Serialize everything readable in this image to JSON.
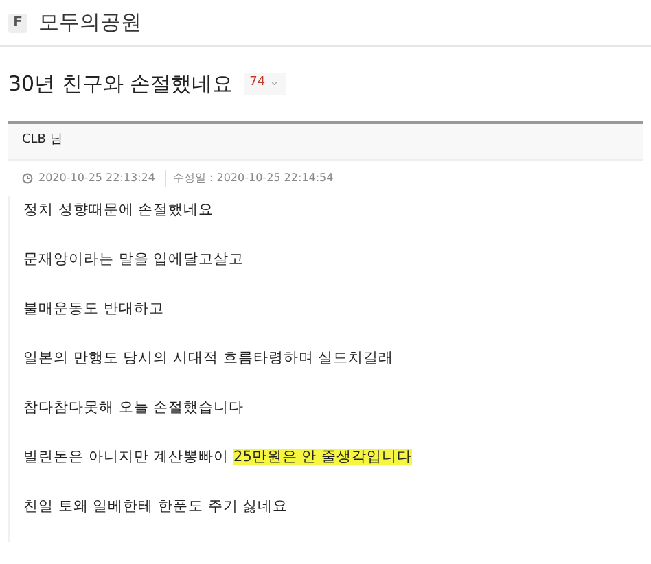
{
  "site": {
    "logo": "F",
    "name": "모두의공원"
  },
  "post": {
    "title": "30년 친구와 손절했네요",
    "comment_count": "74",
    "comment_caret": "⌄",
    "author": "CLB",
    "author_suffix": "님",
    "posted": "2020-10-25 22:13:24",
    "edited_label": "수정일 :",
    "edited": "2020-10-25 22:14:54",
    "lines": [
      {
        "segments": [
          {
            "text": "정치 성향때문에 손절했네요",
            "highlighted": false
          }
        ]
      },
      {
        "segments": [
          {
            "text": "문재앙이라는 말을 입에달고살고",
            "highlighted": false
          }
        ]
      },
      {
        "segments": [
          {
            "text": "불매운동도 반대하고",
            "highlighted": false
          }
        ]
      },
      {
        "segments": [
          {
            "text": "일본의 만행도 당시의 시대적 흐름타령하며 실드치길래",
            "highlighted": false
          }
        ]
      },
      {
        "segments": [
          {
            "text": "참다참다못해 오늘 손절했습니다",
            "highlighted": false
          }
        ]
      },
      {
        "segments": [
          {
            "text": "빌린돈은 아니지만 계산뽕빠이 ",
            "highlighted": false
          },
          {
            "text": "25만원은 안 줄생각입니다",
            "highlighted": true
          }
        ]
      },
      {
        "segments": [
          {
            "text": "친일 토왜 일베한테 한푼도 주기 싫네요",
            "highlighted": false
          }
        ]
      }
    ]
  }
}
